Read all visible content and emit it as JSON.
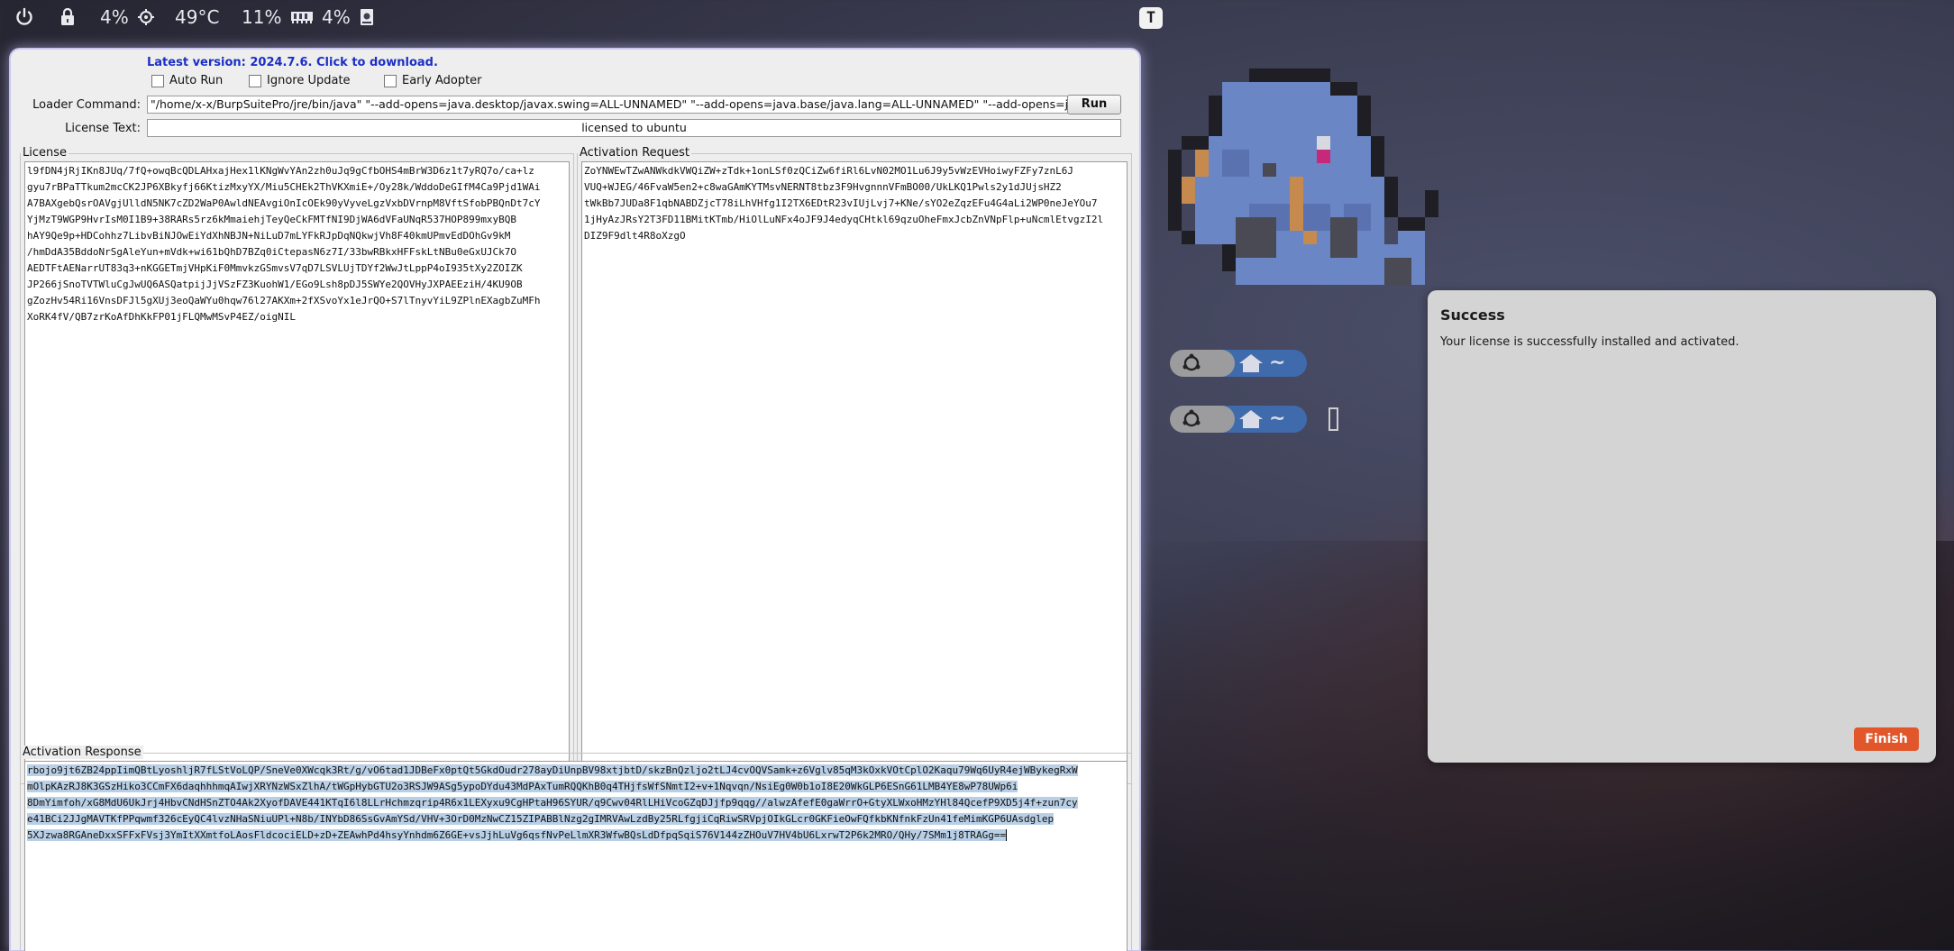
{
  "topbar": {
    "cpu": "4%",
    "temp": "49°C",
    "mem": "11%",
    "disk": "4%",
    "t_logo": "T"
  },
  "loader": {
    "latest_link": "Latest version: 2024.7.6. Click to download.",
    "auto_run": "Auto Run",
    "ignore_update": "Ignore Update",
    "early_adopter": "Early Adopter",
    "loader_command_label": "Loader Command:",
    "loader_command_value": "\"/home/x-x/BurpSuitePro/jre/bin/java\" \"--add-opens=java.desktop/javax.swing=ALL-UNNAMED\" \"--add-opens=java.base/java.lang=ALL-UNNAMED\" \"--add-opens=java.base/jdk.inte",
    "run_label": "Run",
    "license_text_label": "License Text:",
    "license_text_value": "licensed to ubuntu",
    "license_title": "License",
    "license_lines": [
      "l9fDN4jRjIKn8JUq/7fQ+owqBcQDLAHxajHex1lKNgWvYAn2zh0uJq9gCfbOHS4mBrW3D6z1t7yRQ7o/ca+lz",
      "gyu7rBPaTTkum2mcCK2JP6XBkyfj66KtizMxyYX/Miu5CHEk2ThVKXmiE+/Oy28k/WddoDeGIfM4Ca9Pjd1WAi",
      "A7BAXgebQsrOAVgjUlldN5NK7cZD2WaP0AwldNEAvgiOnIcOEk90yVyveLgzVxbDVrnpM8VftSfobPBQnDt7cY",
      "YjMzT9WGP9HvrIsM0I1B9+38RARs5rz6kMmaiehjTeyQeCkFMTfNI9DjWA6dVFaUNqR537HOP899mxyBQB",
      "hAY9Qe9p+HDCohhz7LibvBiNJOwEiYdXhNBJN+NiLuD7mLYFkRJpDqNQkwjVh8F40kmUPmvEdDOhGv9kM",
      "/hmDdA35BddoNrSgAleYun+mVdk+wi61bQhD7BZq0iCtepasN6z7I/33bwRBkxHFFskLtNBu0eGxUJCk7O",
      "AEDTFtAENarrUT83q3+nKGGETmjVHpKiF0MmvkzGSmvsV7qD7LSVLUjTDYf2WwJtLppP4oI935tXy2ZOIZK",
      "JP266jSnoTVTWluCgJwUQ6ASQatpijJjVSzFZ3KuohW1/EGo9Lsh8pDJ5SWYe2QOVHyJXPAEEziH/4KU9OB",
      "gZozHv54Ri16VnsDFJl5gXUj3eoQaWYu0hqw76l27AKXm+2fXSvoYx1eJrQO+S7lTnyvYiL9ZPlnEXagbZuMFh",
      "XoRK4fV/QB7zrKoAfDhKkFP01jFLQMwMSvP4EZ/oigNIL"
    ],
    "activation_request_title": "Activation Request",
    "activation_request_lines": [
      "ZoYNWEwTZwANWkdkVWQiZW+zTdk+1onLSf0zQCiZw6fiRl6LvN02MO1Lu6J9y5vWzEVHoiwyFZFy7znL6J",
      "VUQ+WJEG/46FvaW5en2+c8waGAmKYTMsvNERNT8tbz3F9HvgnnnVFmBO00/UkLKQ1Pwls2y1dJUjsHZ2",
      "tWkBb7JUDa8F1qbNABDZjcT78iLhVHfg1I2TX6EDtR23vIUjLvj7+KNe/sYO2eZqzEFu4G4aLi2WP0neJeYOu7",
      "1jHyAzJRsY2T3FD11BMitKTmb/HiOlLuNFx4oJF9J4edyqCHtkl69qzuOheFmxJcbZnVNpFlp+uNcmlEtvgzI2l",
      "DIZ9F9dlt4R8oXzgO"
    ],
    "activation_response_title": "Activation Response",
    "activation_response_lines": [
      "rbojo9jt6ZB24ppIimQBtLyoshljR7fLStVoLQP/SneVe0XWcqk3Rt/g/vO6tad1JDBeFx0ptQt5GkdOudr278ayDiUnpBV98xtjbtD/skzBnQzljo2tLJ4cvOQVSamk+z6Vglv85qM3kOxkVOtCplO2Kaqu79Wq6UyR4ejWBykegRxW",
      "mOlpKAzRJ8K3GSzHiko3CCmFX6daqhhhmqAIwjXRYNzWSxZlhA/tWGpHybGTU2o3RSJW9ASg5ypoDYdu43MdPAxTumRQQKhB0q4THjfsWfSNmtI2+v+1Nqvqn/NsiEg0W0b1oI8E20WkGLP6ESnG61LMB4YE8wP78UWp6i",
      "8DmYimfoh/xG8MdU6UkJrj4HbvCNdHSnZTO4Ak2XyofDAVE441KTqI6l8LLrHchmzqrip4R6x1LEXyxu9CgHPtaH96SYUR/q9Cwv04RlLHiVcoGZqDJjfp9qqg//alwzAfefE0gaWrrO+GtyXLWxoHMzYHl84QcefP9XD5j4f+zun7cy",
      "e41BCi2JJgMAVTKfPPqwmf326cEyQC4lvzNHaSNiuUPl+N8b/INYbD86SsGvAmYSd/VHV+3OrD0MzNwCZ15ZIPABBlNzg2gIMRVAwLzdBy25RLfgjiCqRiwSRVpjOIkGLcr0GKFieOwFQfkbKNfnkFzUn41feMimKGP6UAsdglep",
      "5XJzwa8RGAneDxxSFFxFVsj3YmItXXmtfoLAosFldcociELD+zD+ZEAwhPd4hsyYnhdm6Z6GE+vsJjhLuVg6qsfNvPeLlmXR3WfwBQsLdDfpqSqiS76V144zZHOuV7HV4bU6LxrwT2P6k2MRO/QHy/7SMm1j8TRAGg=="
    ]
  },
  "dialog": {
    "title": "Success",
    "message": "Your license is successfully installed and activated.",
    "finish_label": "Finish"
  },
  "widgets": {
    "tilde": "~"
  }
}
